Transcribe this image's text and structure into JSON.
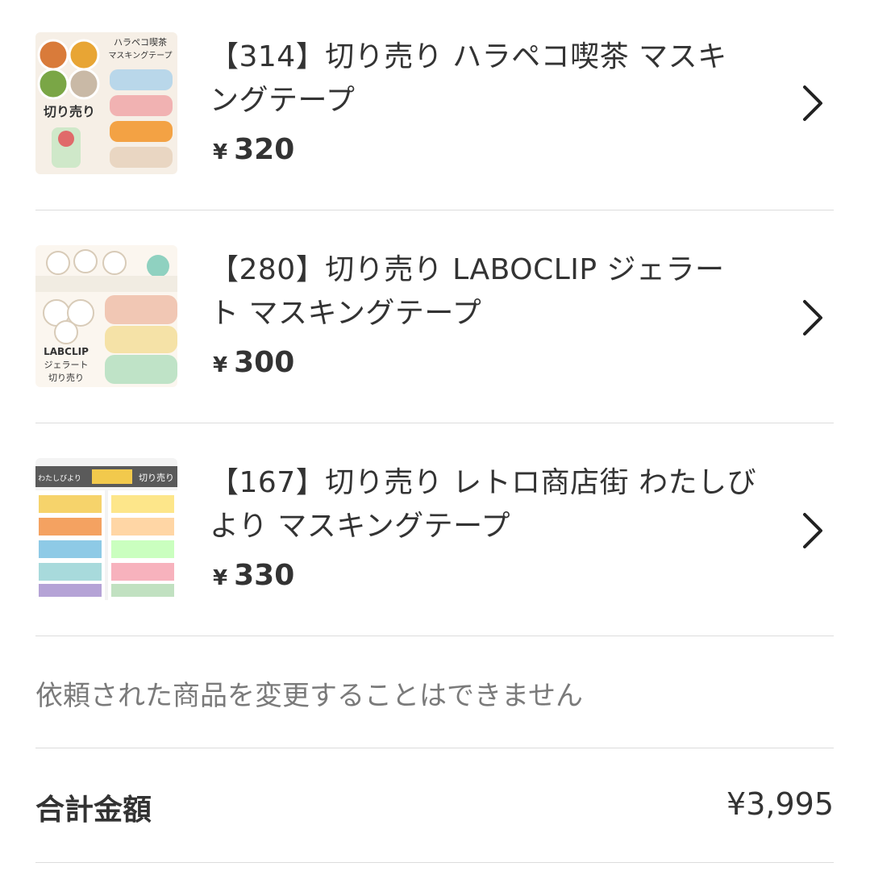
{
  "items": [
    {
      "title_line1": "【314】切り売り ハラペコ喫茶 マスキ",
      "title_line2": "ングテープ",
      "price_symbol": "¥",
      "price": "320",
      "thumb_text_top": "ハラペコ喫茶",
      "thumb_text_sub": "マスキングテープ",
      "thumb_text_side": "切り売り"
    },
    {
      "title_line1": "【280】切り売り LABOCLIP ジェラー",
      "title_line2": "ト マスキングテープ",
      "price_symbol": "¥",
      "price": "300",
      "thumb_text_1": "LABCLIP",
      "thumb_text_2": "ジェラート",
      "thumb_text_3": "切り売り"
    },
    {
      "title_line1": "【167】切り売り レトロ商店街 わたしび",
      "title_line2": "より マスキングテープ",
      "price_symbol": "¥",
      "price": "330",
      "thumb_text_1": "切り売り",
      "thumb_text_2": "わたしびより"
    }
  ],
  "notice": "依頼された商品を変更することはできません",
  "total": {
    "label": "合計金額",
    "value": "¥3,995"
  },
  "colors": {
    "text": "#333333",
    "muted": "#7a7a7a",
    "divider": "#dcdcdc"
  },
  "icons": {
    "row_arrow": "chevron-right-icon"
  }
}
